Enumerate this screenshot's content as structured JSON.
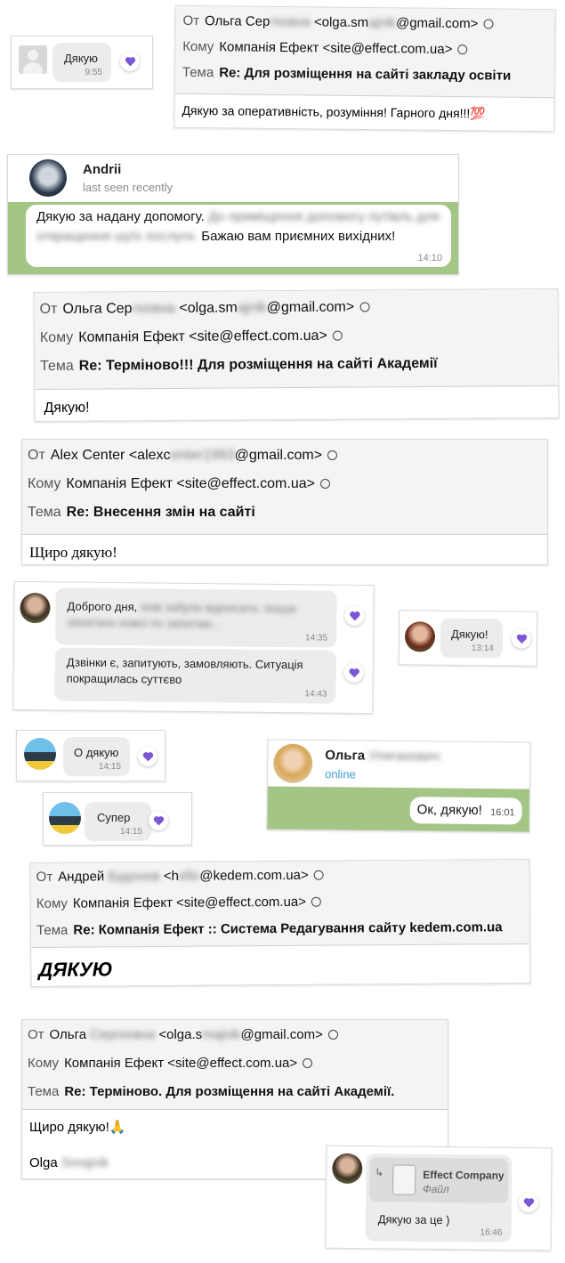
{
  "labels": {
    "from": "От",
    "to": "Кому",
    "subject": "Тема"
  },
  "company": "Компанія Ефект <site@effect.com.ua>",
  "colors": {
    "heart": "#7b57d6",
    "telegram_bg": "#a3c585",
    "online": "#3a9ed8"
  },
  "viber1": {
    "text": "Дякую",
    "time": "9:55"
  },
  "email1": {
    "from_name": "Ольга Сер",
    "from_blur": "гєєвна",
    "from_email_a": "<olga.sm",
    "from_email_blur": "ajnik",
    "from_email_b": "@gmail.com>",
    "subject": "Re: Для розміщення на сайті закладу освіти",
    "body": "Дякую за оперативність, розуміння! Гарного дня!!!💯"
  },
  "telegram1": {
    "name": "Andrii",
    "status": "last seen recently",
    "msg_a": "Дякую за надану допомогу.",
    "msg_blur": "До приміщення допомогу путівль для откращення шуїх послуги.",
    "msg_b": "Бажаю вам приємних вихідних!",
    "time": "14:10"
  },
  "email2": {
    "from_name": "Ольга Сер",
    "from_blur": "гєєвна",
    "from_email_a": "<olga.sm",
    "from_email_blur": "ajnik",
    "from_email_b": "@gmail.com>",
    "subject": "Re: Терміново!!! Для розміщення на сайті Академії",
    "body": "Дякую!"
  },
  "email3": {
    "from_name": "Alex Center",
    "from_email_a": "<alexc",
    "from_email_blur": "enter1993",
    "from_email_b": "@gmail.com>",
    "subject": "Re: Внесення змін на сайті",
    "body": "Щиро дякую!"
  },
  "viber2": {
    "msg1_a": "Доброго дня,",
    "msg1_blur": "нові забули відписати, пошук запитано нової по запитам...",
    "time1": "14:35",
    "msg2": "Дзвінки є, запитують, замовляють. Ситуація покращилась суттєво",
    "time2": "14:43"
  },
  "viber3": {
    "text": "Дякую!",
    "time": "13:14"
  },
  "viber4": {
    "text": "О дякую",
    "time": "14:15"
  },
  "viber5": {
    "text": "Супер",
    "time": "14:15"
  },
  "telegram2": {
    "name": "Ольга",
    "name_blur": "Улиганович",
    "status": "online",
    "msg": "Ок, дякую!",
    "time": "16:01"
  },
  "email4": {
    "from_name": "Андрей",
    "from_blur": "Будонов",
    "from_email_a": "<h",
    "from_email_blur": "ello",
    "from_email_b": "@kedem.com.ua>",
    "subject": "Re: Компанія Ефект :: Система Редагування сайту kedem.com.ua",
    "body": "ДЯКУЮ"
  },
  "email5": {
    "from_name": "Ольга",
    "from_blur": "Сергєєвна",
    "from_email_a": "<olga.s",
    "from_email_blur": "majnik",
    "from_email_b": "@gmail.com>",
    "subject": "Re: Терміново. Для розміщення на сайті Академії.",
    "body": "Щиро дякую!🙏",
    "signature": "Olga",
    "signature_blur": "Smajnik"
  },
  "viber6": {
    "file_sender": "Effect Company",
    "file_label": "Файл",
    "text": "Дякую за це )",
    "time": "16:46"
  }
}
